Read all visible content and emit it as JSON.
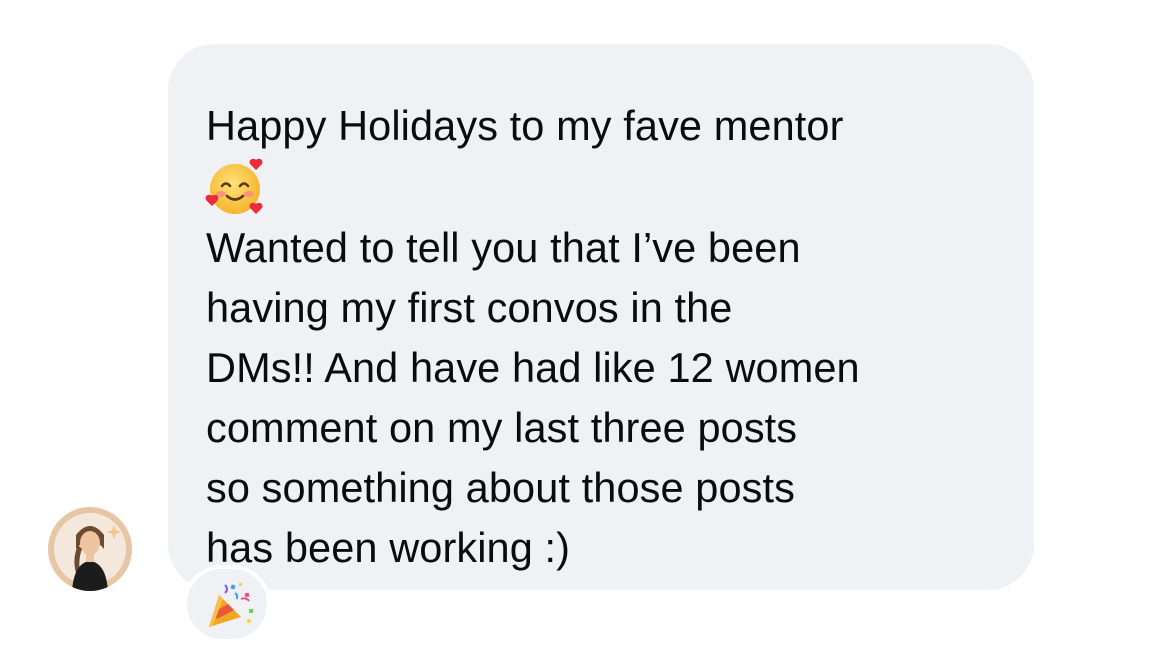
{
  "message": {
    "lines": [
      "Happy Holidays to my fave mentor",
      "Wanted to tell you that I’ve been",
      "having my first convos in the",
      "DMs!! And have had like 12 women",
      "comment on my last three posts",
      "so something about those posts",
      "has been working :)"
    ],
    "inline_emoji": "smiling-face-with-hearts-icon"
  },
  "sender": {
    "avatar_icon": "avatar"
  },
  "reaction": {
    "emoji": "party-popper-icon"
  },
  "colors": {
    "bubble": "#eff1f4",
    "text": "#0b0b0b",
    "background": "#ffffff"
  }
}
